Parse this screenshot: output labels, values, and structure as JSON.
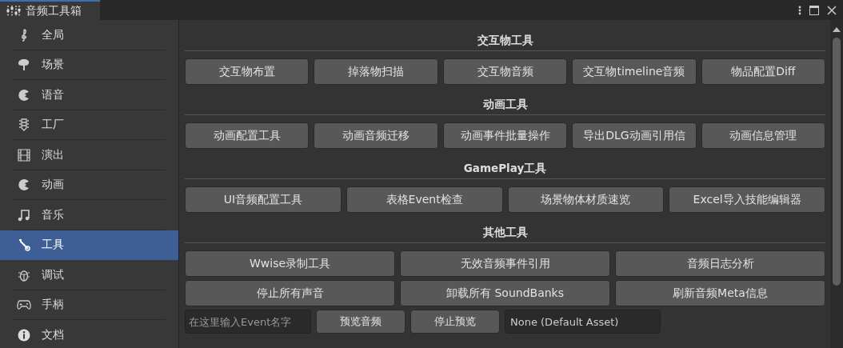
{
  "window": {
    "tab_title": "音频工具箱"
  },
  "sidebar": {
    "items": [
      {
        "label": "全局",
        "selected": false
      },
      {
        "label": "场景",
        "selected": false
      },
      {
        "label": "语音",
        "selected": false
      },
      {
        "label": "工厂",
        "selected": false
      },
      {
        "label": "演出",
        "selected": false
      },
      {
        "label": "动画",
        "selected": false
      },
      {
        "label": "音乐",
        "selected": false
      },
      {
        "label": "工具",
        "selected": true
      },
      {
        "label": "调试",
        "selected": false
      },
      {
        "label": "手柄",
        "selected": false
      },
      {
        "label": "文档",
        "selected": false
      }
    ]
  },
  "sections": [
    {
      "title": "交互物工具",
      "buttons": [
        [
          "交互物布置",
          "掉落物扫描",
          "交互物音频",
          "交互物timeline音频",
          "物品配置Diff"
        ]
      ]
    },
    {
      "title": "动画工具",
      "buttons": [
        [
          "动画配置工具",
          "动画音频迁移",
          "动画事件批量操作",
          "导出DLG动画引用信",
          "动画信息管理"
        ]
      ]
    },
    {
      "title": "GamePlay工具",
      "buttons": [
        [
          "UI音频配置工具",
          "表格Event检查",
          "场景物体材质速览",
          "Excel导入技能编辑器"
        ]
      ]
    },
    {
      "title": "其他工具",
      "buttons": [
        [
          "Wwise录制工具",
          "无效音频事件引用",
          "音频日志分析"
        ],
        [
          "停止所有声音",
          "卸载所有 SoundBanks",
          "刷新音频Meta信息"
        ]
      ]
    }
  ],
  "bottom_bar": {
    "event_field": {
      "placeholder": "在这里输入Event名字"
    },
    "preview_button": "预览音频",
    "stop_button": "停止预览",
    "asset_field": {
      "value": "None (Default Asset)"
    }
  }
}
